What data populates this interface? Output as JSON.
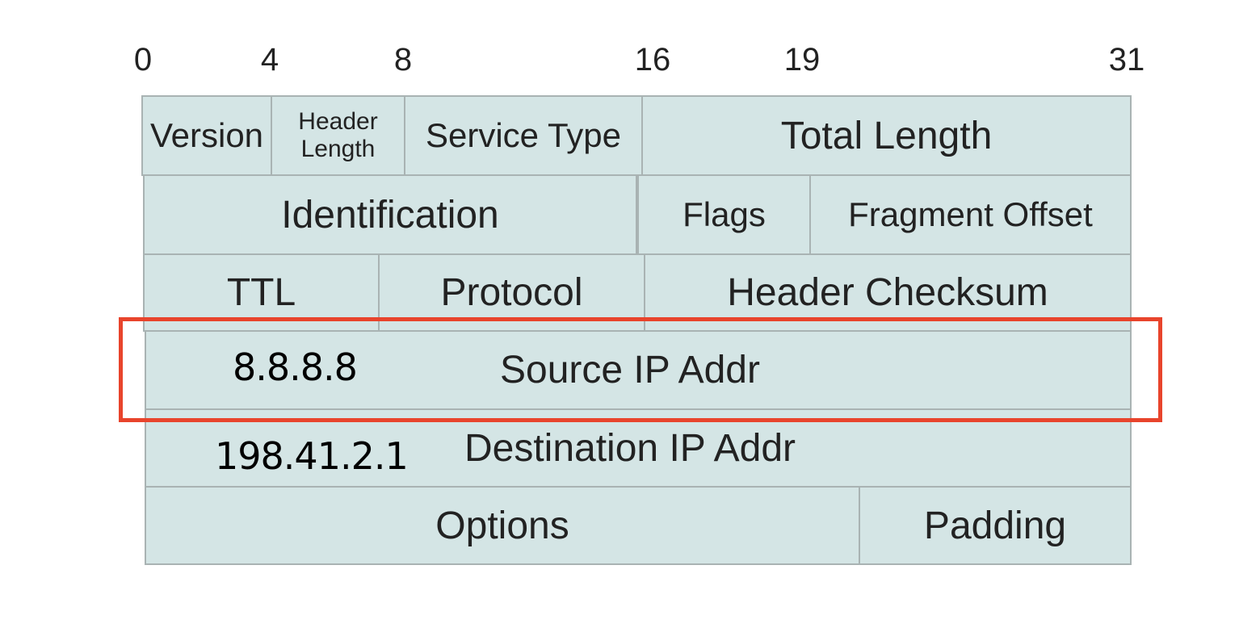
{
  "bit_ticks": [
    "0",
    "4",
    "8",
    "16",
    "19",
    "31"
  ],
  "rows": [
    [
      {
        "label": "Version"
      },
      {
        "label_line1": "Header",
        "label_line2": "Length"
      },
      {
        "label": "Service Type"
      },
      {
        "label": "Total Length"
      }
    ],
    [
      {
        "label": "Identification"
      },
      {
        "label": "Flags"
      },
      {
        "label": "Fragment Offset"
      }
    ],
    [
      {
        "label": "TTL"
      },
      {
        "label": "Protocol"
      },
      {
        "label": "Header Checksum"
      }
    ],
    [
      {
        "label": "Source IP Addr",
        "annotation": "8.8.8.8"
      }
    ],
    [
      {
        "label": "Destination IP Addr",
        "annotation": "198.41.2.1"
      }
    ],
    [
      {
        "label": "Options"
      },
      {
        "label": "Padding"
      }
    ]
  ],
  "highlight": {
    "target": "Source IP Addr",
    "color": "#e8442c"
  },
  "colors": {
    "cell_fill": "#d4e5e5",
    "cell_border": "#a9b3b3"
  }
}
